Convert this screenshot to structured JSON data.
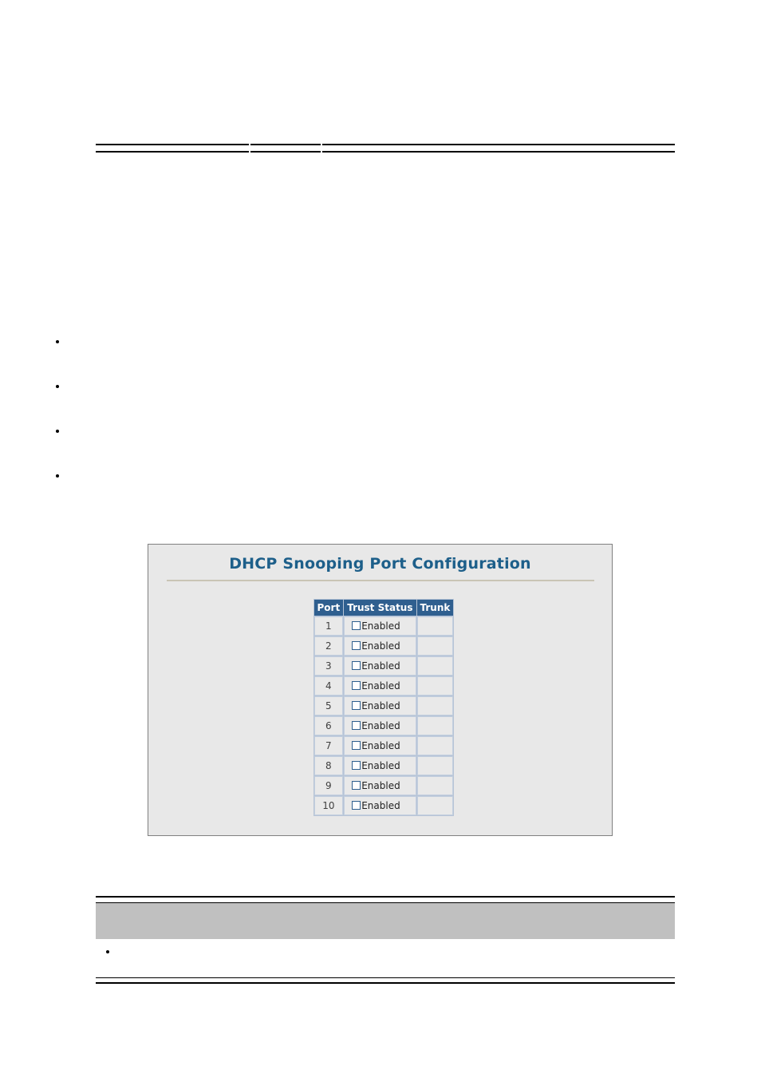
{
  "page": {
    "header_rule_segments": [
      "",
      "",
      ""
    ],
    "body_bullets": [
      {
        "text": ""
      },
      {
        "text": ""
      },
      {
        "text": ""
      },
      {
        "text": ""
      }
    ]
  },
  "screenshot_panel": {
    "title": "DHCP Snooping Port Configuration",
    "title_color": "#1d5f8a",
    "panel_bg": "#e8e8e8",
    "panel_border_color": "#808080",
    "divider_color": "#c9c5b5",
    "table": {
      "header_bg": "#2f5f8f",
      "header_text_color": "#ffffff",
      "cell_bg": "#e9e9e9",
      "cell_border_color": "#c3cfdf",
      "columns": [
        "Port",
        "Trust Status",
        "Trunk"
      ],
      "rows": [
        {
          "port": "1",
          "trust_label": "Enabled",
          "trust_checked": false,
          "trunk": ""
        },
        {
          "port": "2",
          "trust_label": "Enabled",
          "trust_checked": false,
          "trunk": ""
        },
        {
          "port": "3",
          "trust_label": "Enabled",
          "trust_checked": false,
          "trunk": ""
        },
        {
          "port": "4",
          "trust_label": "Enabled",
          "trust_checked": false,
          "trunk": ""
        },
        {
          "port": "5",
          "trust_label": "Enabled",
          "trust_checked": false,
          "trunk": ""
        },
        {
          "port": "6",
          "trust_label": "Enabled",
          "trust_checked": false,
          "trunk": ""
        },
        {
          "port": "7",
          "trust_label": "Enabled",
          "trust_checked": false,
          "trunk": ""
        },
        {
          "port": "8",
          "trust_label": "Enabled",
          "trust_checked": false,
          "trunk": ""
        },
        {
          "port": "9",
          "trust_label": "Enabled",
          "trust_checked": false,
          "trunk": ""
        },
        {
          "port": "10",
          "trust_label": "Enabled",
          "trust_checked": false,
          "trunk": ""
        }
      ]
    }
  },
  "note_block": {
    "header_text": "",
    "header_bg": "#c0c0c0",
    "bullet_text": ""
  }
}
